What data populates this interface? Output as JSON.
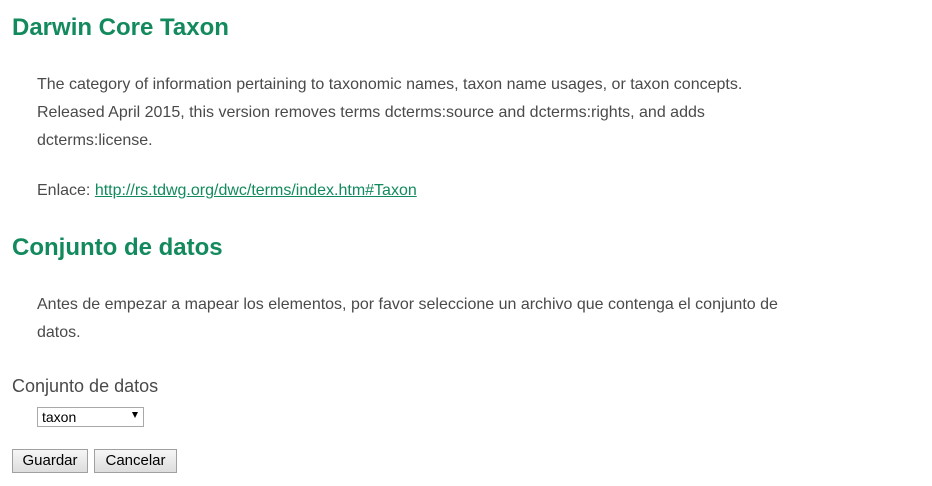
{
  "taxon_section": {
    "title": "Darwin Core Taxon",
    "description_line1": "The category of information pertaining to taxonomic names, taxon name usages, or taxon concepts.",
    "description_line2": "Released April 2015, this version removes terms dcterms:source and dcterms:rights, and adds",
    "description_line3": "dcterms:license.",
    "link_label": "Enlace:",
    "link_url": "http://rs.tdwg.org/dwc/terms/index.htm#Taxon"
  },
  "dataset_section": {
    "title": "Conjunto de datos",
    "instructions_line1": "Antes de empezar a mapear los elementos, por favor seleccione un archivo que contenga el conjunto de",
    "instructions_line2": "datos."
  },
  "dataset_field": {
    "label": "Conjunto de datos",
    "selected_value": "taxon",
    "icon": "chevron-down-icon"
  },
  "actions": {
    "save_label": "Guardar",
    "cancel_label": "Cancelar"
  }
}
